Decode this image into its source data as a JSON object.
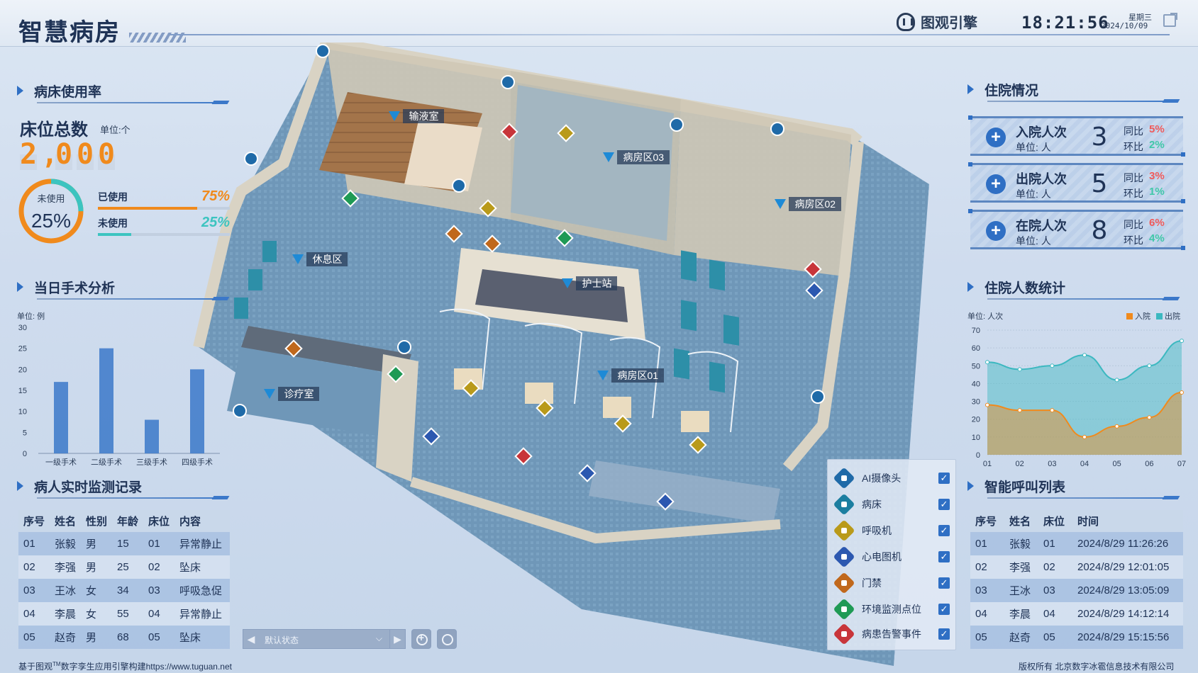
{
  "header": {
    "title": "智慧病房",
    "brand": "图观引擎",
    "time": "18:21:56",
    "weekday": "星期三",
    "date": "2024/10/09"
  },
  "bed_usage": {
    "section_title": "病床使用率",
    "total_label": "床位总数",
    "unit": "单位:个",
    "total_digits": [
      "2",
      ",",
      "0",
      "0",
      "0"
    ],
    "ring_label": "未使用",
    "ring_value": "25%",
    "ring_fraction": 0.25,
    "rows": [
      {
        "label": "已使用",
        "value": "75%",
        "fraction": 0.75,
        "color": "#f08a1c"
      },
      {
        "label": "未使用",
        "value": "25%",
        "fraction": 0.25,
        "color": "#3cc4c0"
      }
    ]
  },
  "surgery": {
    "section_title": "当日手术分析",
    "chart_data": {
      "type": "bar",
      "unit": "单位: 例",
      "categories": [
        "一级手术",
        "二级手术",
        "三级手术",
        "四级手术"
      ],
      "values": [
        17,
        25,
        8,
        20
      ],
      "ylim": [
        0,
        30
      ],
      "yticks": [
        0,
        5,
        10,
        15,
        20,
        25,
        30
      ],
      "grid": false,
      "color": "#3b78c9"
    }
  },
  "monitor": {
    "section_title": "病人实时监测记录",
    "columns": [
      "序号",
      "姓名",
      "性别",
      "年龄",
      "床位",
      "内容"
    ],
    "rows": [
      [
        "01",
        "张毅",
        "男",
        "15",
        "01",
        "异常静止"
      ],
      [
        "02",
        "李强",
        "男",
        "25",
        "02",
        "坠床"
      ],
      [
        "03",
        "王冰",
        "女",
        "34",
        "03",
        "呼吸急促"
      ],
      [
        "04",
        "李晨",
        "女",
        "55",
        "04",
        "异常静止"
      ],
      [
        "05",
        "赵奇",
        "男",
        "68",
        "05",
        "坠床"
      ]
    ]
  },
  "hospitalization": {
    "section_title": "住院情况",
    "yoy_label": "同比",
    "mom_label": "环比",
    "cards": [
      {
        "title": "入院人次",
        "unit": "单位: 人",
        "count": "3",
        "yoy": "5%",
        "mom": "2%"
      },
      {
        "title": "出院人次",
        "unit": "单位: 人",
        "count": "5",
        "yoy": "3%",
        "mom": "1%"
      },
      {
        "title": "在院人次",
        "unit": "单位: 人",
        "count": "8",
        "yoy": "6%",
        "mom": "4%"
      }
    ]
  },
  "inpatient": {
    "section_title": "住院人数统计",
    "chart_data": {
      "type": "area",
      "unit": "单位: 人次",
      "x": [
        "01",
        "02",
        "03",
        "04",
        "05",
        "06",
        "07"
      ],
      "ylim": [
        0,
        70
      ],
      "yticks": [
        0,
        10,
        20,
        30,
        40,
        50,
        60,
        70
      ],
      "legend_position": "top-right",
      "series": [
        {
          "name": "入院",
          "color": "#f08a1c",
          "values": [
            28,
            25,
            25,
            10,
            16,
            21,
            35
          ]
        },
        {
          "name": "出院",
          "color": "#3cb8c0",
          "values": [
            52,
            48,
            50,
            56,
            42,
            50,
            64
          ]
        }
      ]
    }
  },
  "calls": {
    "section_title": "智能呼叫列表",
    "columns": [
      "序号",
      "姓名",
      "床位",
      "时间"
    ],
    "rows": [
      [
        "01",
        "张毅",
        "01",
        "2024/8/29 11:26:26"
      ],
      [
        "02",
        "李强",
        "02",
        "2024/8/29 12:01:05"
      ],
      [
        "03",
        "王冰",
        "03",
        "2024/8/29 13:05:09"
      ],
      [
        "04",
        "李晨",
        "04",
        "2024/8/29 14:12:14"
      ],
      [
        "05",
        "赵奇",
        "05",
        "2024/8/29 15:15:56"
      ]
    ]
  },
  "legend": {
    "items": [
      {
        "label": "AI摄像头",
        "icon": "camera-icon",
        "color": "#1f6aa8"
      },
      {
        "label": "病床",
        "icon": "bed-icon",
        "color": "#1b7ea0"
      },
      {
        "label": "呼吸机",
        "icon": "ventilator-icon",
        "color": "#b99a1a"
      },
      {
        "label": "心电图机",
        "icon": "ecg-icon",
        "color": "#2c58b0"
      },
      {
        "label": "门禁",
        "icon": "door-access-icon",
        "color": "#c0681c"
      },
      {
        "label": "环境监测点位",
        "icon": "environment-sensor-icon",
        "color": "#1f9a55"
      },
      {
        "label": "病患告警事件",
        "icon": "alarm-icon",
        "color": "#c8353a"
      }
    ]
  },
  "scene": {
    "labels": [
      "输液室",
      "病房区03",
      "病房区02",
      "休息区",
      "护士站",
      "病房区01",
      "诊疗室"
    ]
  },
  "controls": {
    "state_label": "默认状态"
  },
  "footer": {
    "left_prefix": "基于图观",
    "left_tm": "TM",
    "left_suffix": "数字孪生应用引擎构建https://www.tuguan.net",
    "right": "版权所有  北京数字冰雹信息技术有限公司"
  }
}
